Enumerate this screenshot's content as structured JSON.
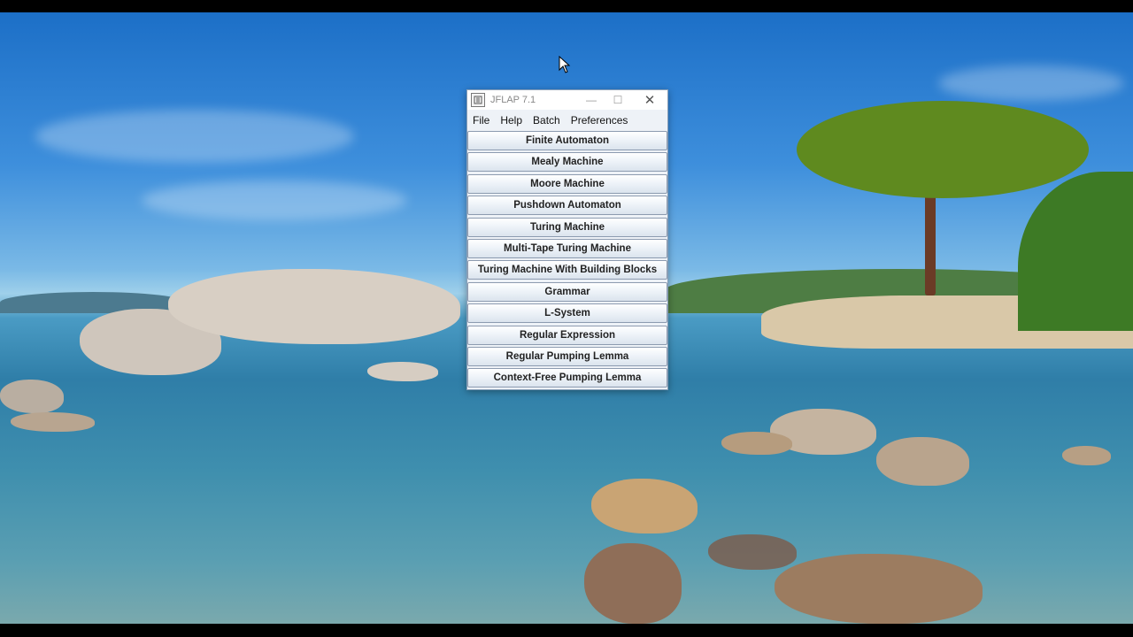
{
  "window": {
    "title": "JFLAP 7.1",
    "controls": {
      "minimize": "—",
      "maximize": "☐",
      "close": "✕"
    }
  },
  "menu": [
    "File",
    "Help",
    "Batch",
    "Preferences"
  ],
  "buttons": [
    "Finite Automaton",
    "Mealy Machine",
    "Moore Machine",
    "Pushdown Automaton",
    "Turing Machine",
    "Multi-Tape Turing Machine",
    "Turing Machine With Building Blocks",
    "Grammar",
    "L-System",
    "Regular Expression",
    "Regular Pumping Lemma",
    "Context-Free Pumping Lemma"
  ],
  "desktop": {
    "wallpaper": "beach-landscape",
    "icons": [
      "mouse-cursor-icon",
      "java-app-icon"
    ]
  }
}
